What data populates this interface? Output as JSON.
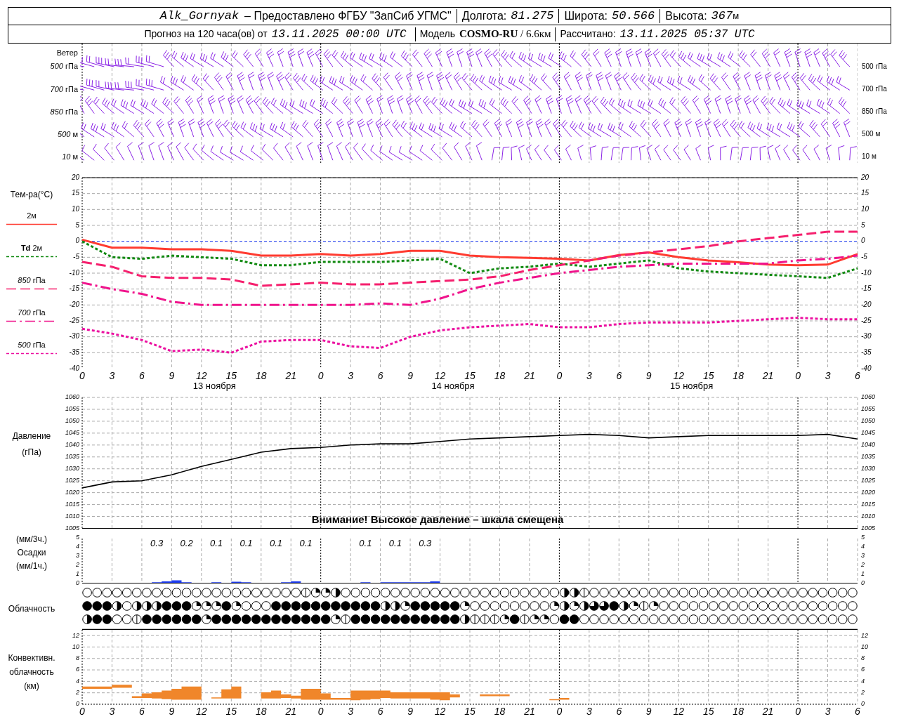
{
  "header": {
    "station": "Alk_Gornyak",
    "provider": "– Предоставлено ФГБУ \"ЗапСиб УГМС\"",
    "fields": [
      {
        "label": "Долгота:",
        "value": "81.275"
      },
      {
        "label": "Широта:",
        "value": "50.566"
      },
      {
        "label": "Высота:",
        "value": "367",
        "unit": "м"
      }
    ]
  },
  "subheader": {
    "forecast": "Прогноз на 120 часа(ов) от",
    "start": "13.11.2025 00:00 UTC",
    "model_label": "Модель",
    "model": "**COSMO-RU** / 6.6км",
    "computed_label": "Рассчитано:",
    "computed": "13.11.2025 05:37 UTC"
  },
  "wind": {
    "title": "Ветер",
    "levels": [
      {
        "left": "*500* гПа",
        "right": "500 гПа"
      },
      {
        "left": "*700* гПа",
        "right": "700 гПа"
      },
      {
        "left": "*850* гПа",
        "right": "850 гПа"
      },
      {
        "left": "*500* м",
        "right": "500 м"
      },
      {
        "left": "*10* м",
        "right": "10 м"
      }
    ]
  },
  "temperature": {
    "title": "Тем-ра(°С)",
    "right_ticks": [
      "20",
      "15",
      "10",
      "5",
      "0",
      "-5",
      "-10",
      "-15",
      "-20",
      "-25",
      "-30",
      "-35",
      "-40"
    ],
    "day_labels": [
      "13 ноября",
      "14 ноября",
      "15 ноября"
    ],
    "chart_data": {
      "type": "line",
      "grid": true,
      "categories": [
        "0",
        "3",
        "6",
        "9",
        "12",
        "15",
        "18",
        "21",
        "0",
        "3",
        "6",
        "9",
        "12",
        "15",
        "18",
        "21",
        "0",
        "3",
        "6",
        "9",
        "12",
        "15",
        "18",
        "21",
        "0",
        "3",
        "6"
      ],
      "ylim": [
        -40,
        20
      ],
      "yticks": [
        20,
        15,
        10,
        5,
        0,
        -5,
        -10,
        -15,
        -20,
        -25,
        -30,
        -35,
        -40
      ],
      "ref_lines": [
        {
          "axis": "y",
          "value": 0,
          "color": "#2040ff",
          "line_style": "dotted"
        }
      ],
      "series": [
        {
          "name": "2м",
          "line_style": "solid",
          "color": "#ff3b30",
          "values": [
            0.5,
            -2,
            -2,
            -2.5,
            -2.5,
            -3,
            -4.5,
            -4.5,
            -4,
            -4.5,
            -4,
            -3,
            -3,
            -4.5,
            -5,
            -5.2,
            -5.5,
            -6,
            -4.3,
            -3.5,
            -5,
            -6,
            -6.6,
            -7.3,
            -7.5,
            -7.3,
            -4
          ]
        },
        {
          "name": "**Td** 2м",
          "line_style": "dotted",
          "color": "#128a12",
          "values": [
            0,
            -5,
            -5.5,
            -4.5,
            -5,
            -5.5,
            -7.5,
            -7.5,
            -6.5,
            -6.5,
            -6.5,
            -6,
            -5.5,
            -10,
            -8.5,
            -8,
            -7,
            -8,
            -7,
            -6,
            -8.5,
            -9.5,
            -10,
            -10.5,
            -11,
            -11.5,
            -8.5
          ]
        },
        {
          "name": "*850* гПа",
          "line_style": "dashed",
          "color": "#f5206e",
          "values": [
            -6.5,
            -8,
            -11,
            -11.5,
            -11.5,
            -12,
            -14,
            -13.5,
            -13,
            -13.5,
            -13.5,
            -13,
            -12.5,
            -12,
            -11,
            -9,
            -7.5,
            -6,
            -4.5,
            -3.5,
            -2.5,
            -1.5,
            0,
            1,
            2,
            3,
            3
          ]
        },
        {
          "name": "*700* гПа",
          "line_style": "dashdot",
          "color": "#f0148c",
          "values": [
            -13,
            -15,
            -16.5,
            -19,
            -20,
            -20,
            -20,
            -20,
            -20,
            -20,
            -19.5,
            -20,
            -18,
            -15,
            -13,
            -11.5,
            -10,
            -9,
            -8,
            -7.5,
            -7,
            -7,
            -7,
            -7,
            -6,
            -5.5,
            -4.5
          ]
        },
        {
          "name": "*500* гПа",
          "line_style": "dotted",
          "color": "#eb10a0",
          "values": [
            -27.5,
            -29,
            -31,
            -34.5,
            -34,
            -35,
            -31.5,
            -31,
            -31,
            -33,
            -33.5,
            -30,
            -28,
            -27,
            -26.5,
            -26,
            -27,
            -27,
            -26,
            -25.5,
            -25.5,
            -25.5,
            -25,
            -24.5,
            -24,
            -24.5,
            -24.5
          ]
        }
      ]
    }
  },
  "pressure": {
    "title": "Давление",
    "unit": "(гПа)",
    "warning": "Внимание! Высокое давление – шкала смещена",
    "right_ticks": [
      "1060",
      "1055",
      "1050",
      "1045",
      "1040",
      "1035",
      "1030",
      "1025",
      "1020",
      "1015",
      "1010",
      "1005"
    ],
    "chart_data": {
      "type": "line",
      "grid": true,
      "categories": [
        null,
        null,
        null,
        null,
        null,
        null,
        null,
        null,
        null,
        null,
        null,
        null,
        null,
        null,
        null,
        null,
        null,
        null,
        null,
        null,
        null,
        null,
        null,
        null,
        null,
        null,
        null
      ],
      "ylim": [
        1005,
        1060
      ],
      "yticks": [
        1060,
        1055,
        1050,
        1045,
        1040,
        1035,
        1030,
        1025,
        1020,
        1015,
        1010,
        1005
      ],
      "series": [
        {
          "color": "#000000",
          "values": [
            1022,
            1024.5,
            1025,
            1027.5,
            1031,
            1034,
            1037,
            1038.5,
            1039,
            1040,
            1040.5,
            1040.5,
            1041.5,
            1042.5,
            1043,
            1043.5,
            1044,
            1044.5,
            1044,
            1043,
            1043.5,
            1044,
            1044,
            1044,
            1044,
            1044.5,
            1042.5
          ]
        }
      ]
    }
  },
  "precipitation": {
    "labels": [
      "(мм/3ч.)",
      "Осадки",
      "(мм/1ч.)"
    ],
    "left_ticks": [
      "5",
      "4",
      "3",
      "2",
      "1",
      "0"
    ],
    "right_ticks": [
      "5",
      "4",
      "3",
      "2",
      "1",
      "0"
    ],
    "totals": [
      {
        "text": "0.3"
      },
      {
        "text": "0.2"
      },
      {
        "text": "0.1"
      },
      {
        "text": "0.1"
      },
      {
        "text": "0.1"
      },
      {
        "text": "0.1"
      },
      {
        "text": "0.1"
      },
      {
        "text": "0.1"
      },
      {
        "text": "0.3"
      }
    ]
  },
  "cloudiness": {
    "title": "Облачность",
    "rows": [
      {
        "cells": [
          {
            "kind": "clear"
          },
          {
            "kind": "clear"
          },
          {
            "kind": "clear"
          },
          {
            "kind": "clear"
          },
          {
            "kind": "clear"
          },
          {
            "kind": "clear"
          },
          {
            "kind": "clear"
          },
          {
            "kind": "clear"
          },
          {
            "kind": "clear"
          },
          {
            "kind": "clear"
          },
          {
            "kind": "clear"
          },
          {
            "kind": "clear"
          },
          {
            "kind": "clear"
          },
          {
            "kind": "clear"
          },
          {
            "kind": "clear"
          },
          {
            "kind": "clear"
          },
          {
            "kind": "clear"
          },
          {
            "kind": "clear"
          },
          {
            "kind": "clear"
          },
          {
            "kind": "clear"
          },
          {
            "kind": "clear"
          },
          {
            "kind": "clear"
          },
          {
            "kind": "line"
          },
          {
            "kind": "quarter"
          },
          {
            "kind": "quarter"
          },
          {
            "kind": "half"
          },
          {
            "kind": "clear"
          },
          {
            "kind": "clear"
          },
          {
            "kind": "clear"
          },
          {
            "kind": "clear"
          },
          {
            "kind": "clear"
          },
          {
            "kind": "clear"
          },
          {
            "kind": "clear"
          },
          {
            "kind": "clear"
          },
          {
            "kind": "clear"
          },
          {
            "kind": "clear"
          },
          {
            "kind": "clear"
          },
          {
            "kind": "clear"
          },
          {
            "kind": "clear"
          },
          {
            "kind": "clear"
          },
          {
            "kind": "clear"
          },
          {
            "kind": "clear"
          },
          {
            "kind": "clear"
          },
          {
            "kind": "clear"
          },
          {
            "kind": "clear"
          },
          {
            "kind": "clear"
          },
          {
            "kind": "clear"
          },
          {
            "kind": "clear"
          },
          {
            "kind": "half"
          },
          {
            "kind": "half"
          },
          {
            "kind": "line"
          },
          {
            "kind": "clear"
          },
          {
            "kind": "clear"
          },
          {
            "kind": "clear"
          },
          {
            "kind": "clear"
          },
          {
            "kind": "clear"
          },
          {
            "kind": "clear"
          },
          {
            "kind": "clear"
          },
          {
            "kind": "clear"
          },
          {
            "kind": "clear"
          },
          {
            "kind": "clear"
          },
          {
            "kind": "clear"
          },
          {
            "kind": "clear"
          },
          {
            "kind": "clear"
          },
          {
            "kind": "clear"
          },
          {
            "kind": "clear"
          },
          {
            "kind": "clear"
          },
          {
            "kind": "clear"
          },
          {
            "kind": "clear"
          },
          {
            "kind": "clear"
          },
          {
            "kind": "clear"
          },
          {
            "kind": "clear"
          },
          {
            "kind": "clear"
          },
          {
            "kind": "clear"
          },
          {
            "kind": "clear"
          },
          {
            "kind": "clear"
          },
          {
            "kind": "clear"
          },
          {
            "kind": "clear"
          }
        ]
      },
      {
        "cells": [
          {
            "kind": "overcast"
          },
          {
            "kind": "overcast"
          },
          {
            "kind": "overcast"
          },
          {
            "kind": "half"
          },
          {
            "kind": "clear"
          },
          {
            "kind": "half"
          },
          {
            "kind": "half"
          },
          {
            "kind": "half"
          },
          {
            "kind": "overcast"
          },
          {
            "kind": "overcast"
          },
          {
            "kind": "overcast"
          },
          {
            "kind": "quarter"
          },
          {
            "kind": "quarter"
          },
          {
            "kind": "quarter"
          },
          {
            "kind": "overcast"
          },
          {
            "kind": "quarter"
          },
          {
            "kind": "clear"
          },
          {
            "kind": "clear"
          },
          {
            "kind": "clear"
          },
          {
            "kind": "overcast"
          },
          {
            "kind": "overcast"
          },
          {
            "kind": "overcast"
          },
          {
            "kind": "overcast"
          },
          {
            "kind": "overcast"
          },
          {
            "kind": "overcast"
          },
          {
            "kind": "overcast"
          },
          {
            "kind": "overcast"
          },
          {
            "kind": "overcast"
          },
          {
            "kind": "overcast"
          },
          {
            "kind": "overcast"
          },
          {
            "kind": "half"
          },
          {
            "kind": "half"
          },
          {
            "kind": "quarter"
          },
          {
            "kind": "overcast"
          },
          {
            "kind": "overcast"
          },
          {
            "kind": "overcast"
          },
          {
            "kind": "overcast"
          },
          {
            "kind": "overcast"
          },
          {
            "kind": "quarter"
          },
          {
            "kind": "clear"
          },
          {
            "kind": "clear"
          },
          {
            "kind": "clear"
          },
          {
            "kind": "clear"
          },
          {
            "kind": "clear"
          },
          {
            "kind": "clear"
          },
          {
            "kind": "clear"
          },
          {
            "kind": "clear"
          },
          {
            "kind": "quarter"
          },
          {
            "kind": "half"
          },
          {
            "kind": "quarter"
          },
          {
            "kind": "half"
          },
          {
            "kind": "three_quarters"
          },
          {
            "kind": "three_quarters"
          },
          {
            "kind": "overcast"
          },
          {
            "kind": "half"
          },
          {
            "kind": "quarter"
          },
          {
            "kind": "line"
          },
          {
            "kind": "quarter"
          },
          {
            "kind": "clear"
          },
          {
            "kind": "clear"
          },
          {
            "kind": "clear"
          },
          {
            "kind": "clear"
          },
          {
            "kind": "clear"
          },
          {
            "kind": "clear"
          },
          {
            "kind": "clear"
          },
          {
            "kind": "clear"
          },
          {
            "kind": "clear"
          },
          {
            "kind": "clear"
          },
          {
            "kind": "clear"
          },
          {
            "kind": "clear"
          },
          {
            "kind": "clear"
          },
          {
            "kind": "clear"
          },
          {
            "kind": "clear"
          },
          {
            "kind": "clear"
          },
          {
            "kind": "clear"
          },
          {
            "kind": "clear"
          },
          {
            "kind": "clear"
          },
          {
            "kind": "clear"
          }
        ]
      },
      {
        "cells": [
          {
            "kind": "half"
          },
          {
            "kind": "overcast"
          },
          {
            "kind": "overcast"
          },
          {
            "kind": "clear"
          },
          {
            "kind": "clear"
          },
          {
            "kind": "line"
          },
          {
            "kind": "overcast"
          },
          {
            "kind": "overcast"
          },
          {
            "kind": "overcast"
          },
          {
            "kind": "overcast"
          },
          {
            "kind": "overcast"
          },
          {
            "kind": "overcast"
          },
          {
            "kind": "quarter"
          },
          {
            "kind": "overcast"
          },
          {
            "kind": "overcast"
          },
          {
            "kind": "overcast"
          },
          {
            "kind": "overcast"
          },
          {
            "kind": "overcast"
          },
          {
            "kind": "overcast"
          },
          {
            "kind": "overcast"
          },
          {
            "kind": "overcast"
          },
          {
            "kind": "overcast"
          },
          {
            "kind": "overcast"
          },
          {
            "kind": "overcast"
          },
          {
            "kind": "overcast"
          },
          {
            "kind": "quarter"
          },
          {
            "kind": "line"
          },
          {
            "kind": "overcast"
          },
          {
            "kind": "overcast"
          },
          {
            "kind": "overcast"
          },
          {
            "kind": "overcast"
          },
          {
            "kind": "overcast"
          },
          {
            "kind": "overcast"
          },
          {
            "kind": "overcast"
          },
          {
            "kind": "overcast"
          },
          {
            "kind": "overcast"
          },
          {
            "kind": "overcast"
          },
          {
            "kind": "overcast"
          },
          {
            "kind": "half"
          },
          {
            "kind": "line"
          },
          {
            "kind": "line"
          },
          {
            "kind": "line"
          },
          {
            "kind": "quarter"
          },
          {
            "kind": "overcast"
          },
          {
            "kind": "line"
          },
          {
            "kind": "quarter"
          },
          {
            "kind": "quarter"
          },
          {
            "kind": "clear"
          },
          {
            "kind": "overcast"
          },
          {
            "kind": "overcast"
          },
          {
            "kind": "clear"
          },
          {
            "kind": "clear"
          },
          {
            "kind": "clear"
          },
          {
            "kind": "clear"
          },
          {
            "kind": "clear"
          },
          {
            "kind": "clear"
          },
          {
            "kind": "clear"
          },
          {
            "kind": "clear"
          },
          {
            "kind": "clear"
          },
          {
            "kind": "clear"
          },
          {
            "kind": "clear"
          },
          {
            "kind": "clear"
          },
          {
            "kind": "clear"
          },
          {
            "kind": "clear"
          },
          {
            "kind": "clear"
          },
          {
            "kind": "clear"
          },
          {
            "kind": "clear"
          },
          {
            "kind": "clear"
          },
          {
            "kind": "clear"
          },
          {
            "kind": "clear"
          },
          {
            "kind": "clear"
          },
          {
            "kind": "clear"
          },
          {
            "kind": "clear"
          },
          {
            "kind": "clear"
          },
          {
            "kind": "clear"
          },
          {
            "kind": "clear"
          },
          {
            "kind": "clear"
          },
          {
            "kind": "clear"
          }
        ]
      }
    ]
  },
  "convective": {
    "labels": [
      "Конвективн.",
      "облачность",
      "(км)"
    ],
    "left_ticks": [
      "12",
      "10",
      "8",
      "6",
      "4",
      "2",
      "0"
    ],
    "right_ticks": [
      "12",
      "10",
      "8",
      "6",
      "4",
      "2",
      "0"
    ],
    "hour_labels": [
      "0",
      "3",
      "6",
      "9",
      "12",
      "15",
      "18",
      "21",
      "0",
      "3",
      "6",
      "9",
      "12",
      "15",
      "18",
      "21",
      "0",
      "3",
      "6",
      "9",
      "12",
      "15",
      "18",
      "21",
      "0",
      "3",
      "6"
    ]
  }
}
